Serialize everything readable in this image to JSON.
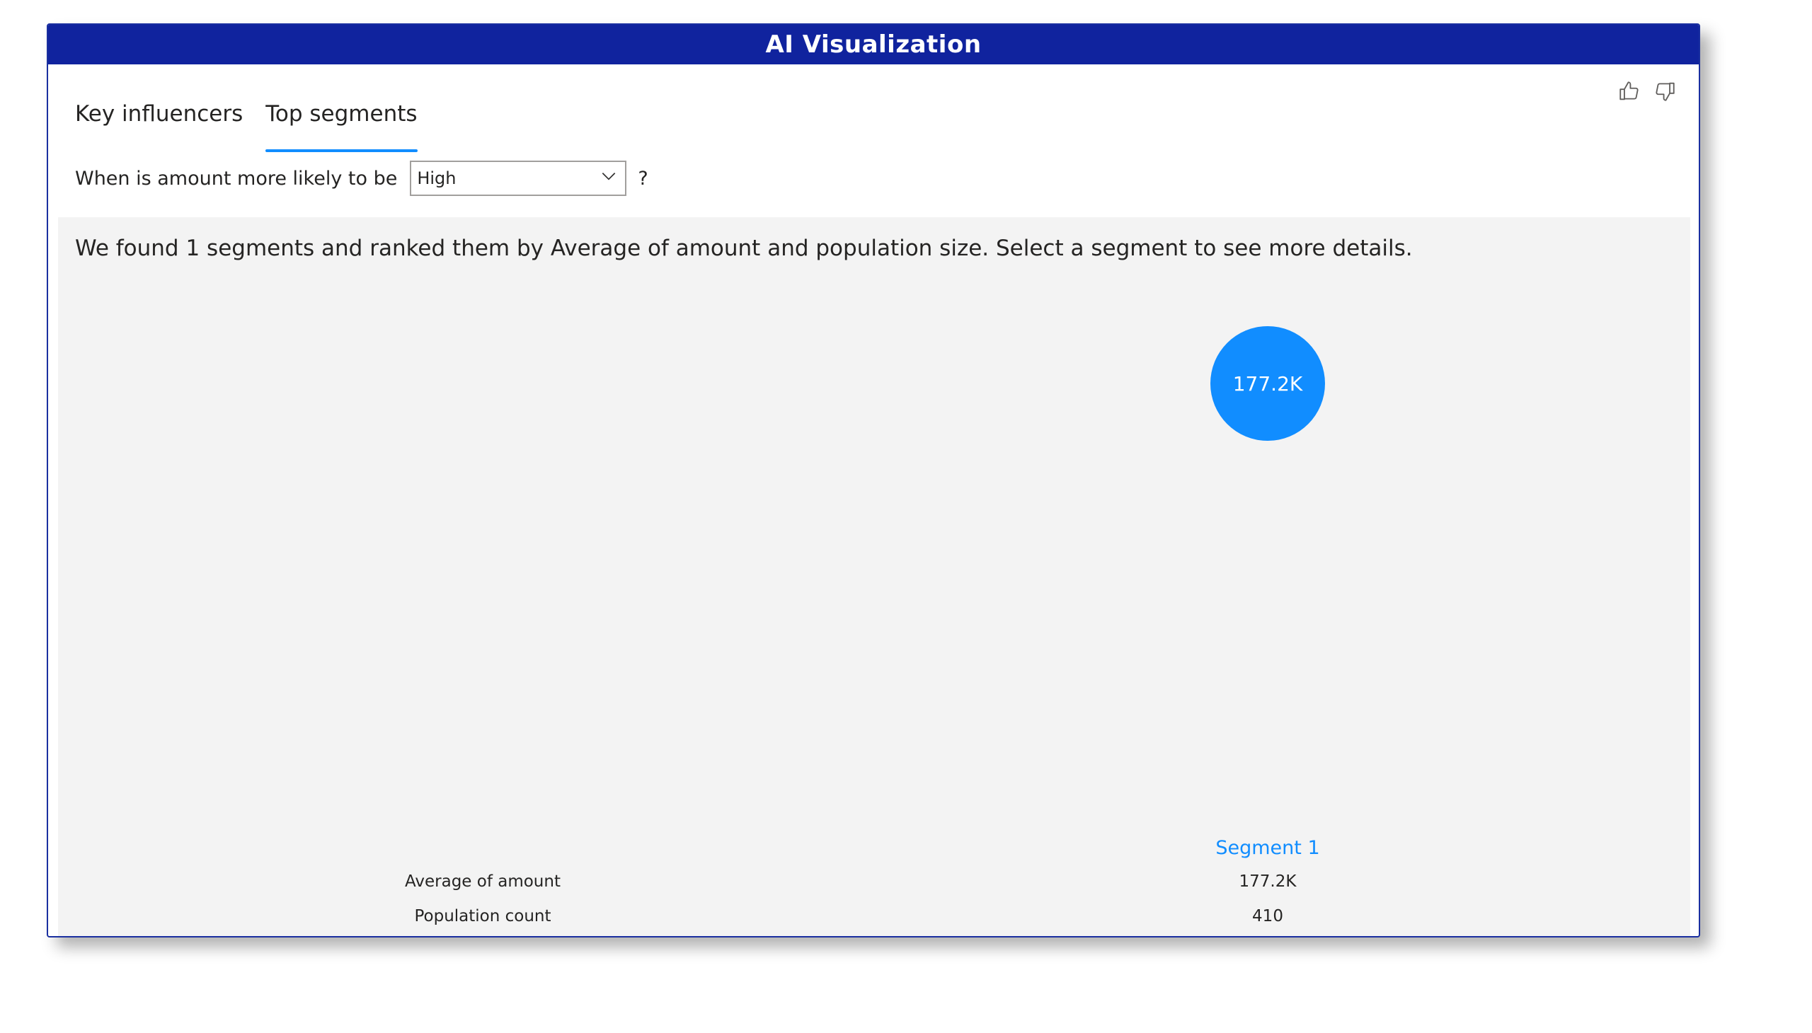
{
  "window": {
    "title": "AI Visualization"
  },
  "tabs": [
    {
      "label": "Key influencers",
      "active": false
    },
    {
      "label": "Top segments",
      "active": true
    }
  ],
  "feedback": {
    "like_icon": "thumbs-up-icon",
    "dislike_icon": "thumbs-down-icon"
  },
  "question": {
    "prefix": "When is amount more likely to be",
    "selected": "High",
    "suffix": "?"
  },
  "panel": {
    "summary": "We found 1 segments and ranked them by Average of amount and population size. Select a segment to see more details."
  },
  "segments": [
    {
      "name": "Segment 1",
      "bubble_label": "177.2K",
      "average_of_amount": "177.2K",
      "population_count": "410"
    }
  ],
  "metrics": {
    "average_label": "Average of amount",
    "population_label": "Population count"
  },
  "colors": {
    "titlebar": "#10239e",
    "accent": "#118dff",
    "panel_bg": "#f3f3f3"
  }
}
